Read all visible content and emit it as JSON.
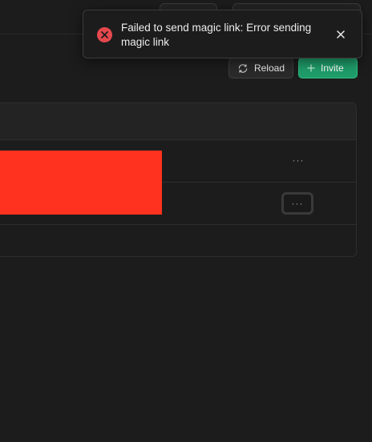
{
  "toast": {
    "message": "Failed to send magic link: Error sending magic link",
    "icon": "error-x-icon",
    "close_icon": "close-icon"
  },
  "toolbar": {
    "reload_label": "Reload",
    "invite_label": "Invite"
  },
  "table": {
    "rows": [
      {
        "actions_label": "···"
      },
      {
        "actions_label": "···"
      }
    ]
  },
  "colors": {
    "error": "#e5484d",
    "accent": "#1f9d6a",
    "redaction": "#ff3220"
  }
}
